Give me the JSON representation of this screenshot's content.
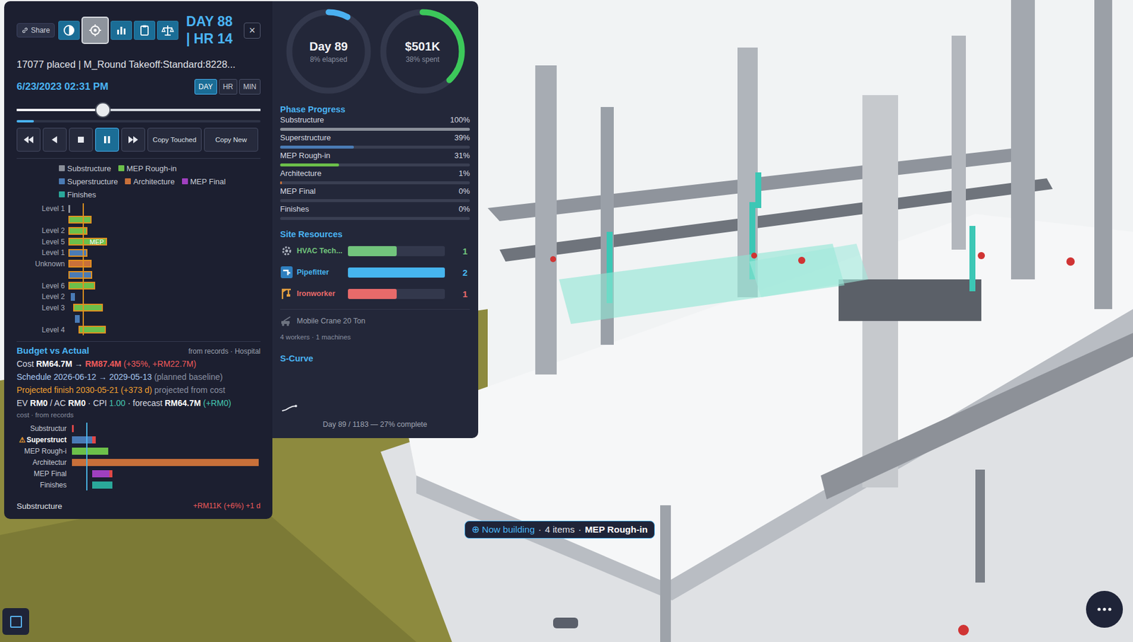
{
  "toolbar": {
    "share": "Share",
    "tools": [
      {
        "kind": "contrast",
        "selected": false
      },
      {
        "kind": "target",
        "selected": true
      },
      {
        "kind": "chart",
        "selected": false
      },
      {
        "kind": "clipboard",
        "selected": false
      },
      {
        "kind": "scales",
        "selected": false
      }
    ],
    "close": "×"
  },
  "clock": {
    "day": "DAY 88",
    "hour": "| HR 14"
  },
  "status": "17077 placed | M_Round Takeoff:Standard:8228...",
  "datetime": "6/23/2023 02:31 PM",
  "granularity": [
    {
      "label": "DAY",
      "selected": true
    },
    {
      "label": "HR",
      "selected": false
    },
    {
      "label": "MIN",
      "selected": false
    }
  ],
  "timeline": {
    "level": 0.354,
    "progress": 0.07
  },
  "playback": [
    {
      "kind": "rewind",
      "label": "",
      "selected": false
    },
    {
      "kind": "back",
      "label": "",
      "selected": false
    },
    {
      "kind": "stop",
      "label": "",
      "selected": false
    },
    {
      "kind": "pause",
      "label": "",
      "selected": true
    },
    {
      "kind": "forward",
      "label": "",
      "selected": false
    },
    {
      "kind": "text",
      "label": "Copy Touched",
      "selected": false
    },
    {
      "kind": "text",
      "label": "Copy New",
      "selected": false
    }
  ],
  "legend": [
    [
      {
        "label": "Substructure",
        "color": "#8a8f99"
      },
      {
        "label": "MEP Rough-in",
        "color": "#6cc04a"
      }
    ],
    [
      {
        "label": "Superstructure",
        "color": "#4a7bb5"
      },
      {
        "label": "Architecture",
        "color": "#c8703a"
      },
      {
        "label": "MEP Final",
        "color": "#a040c0"
      }
    ],
    [
      {
        "label": "Finishes",
        "color": "#2aa89a"
      }
    ]
  ],
  "schedule_chart": {
    "today": 0.075,
    "rows": [
      {
        "label": "Level 1",
        "start": 0,
        "end": 0.008,
        "color": "#8a8f99",
        "highlighted": false,
        "text": ""
      },
      {
        "label": "",
        "start": 0,
        "end": 0.12,
        "color": "#6cc04a",
        "highlighted": true,
        "text": ""
      },
      {
        "label": "Level 2",
        "start": 0,
        "end": 0.098,
        "color": "#6cc04a",
        "highlighted": true,
        "text": ""
      },
      {
        "label": "Level 5",
        "start": 0,
        "end": 0.2,
        "color": "#6cc04a",
        "highlighted": true,
        "text": "MEP"
      },
      {
        "label": "Level 1",
        "start": 0,
        "end": 0.098,
        "color": "#4a7bb5",
        "highlighted": true,
        "text": ""
      },
      {
        "label": "Unknown",
        "start": 0,
        "end": 0.12,
        "color": "#c8703a",
        "highlighted": true,
        "text": ""
      },
      {
        "label": "",
        "start": 0,
        "end": 0.124,
        "color": "#4a7bb5",
        "highlighted": true,
        "text": ""
      },
      {
        "label": "Level 6",
        "start": 0,
        "end": 0.139,
        "color": "#6cc04a",
        "highlighted": true,
        "text": ""
      },
      {
        "label": "Level 2",
        "start": 0.011,
        "end": 0.034,
        "color": "#4a7bb5",
        "highlighted": false,
        "text": ""
      },
      {
        "label": "Level 3",
        "start": 0.026,
        "end": 0.18,
        "color": "#6cc04a",
        "highlighted": true,
        "text": ""
      },
      {
        "label": "",
        "start": 0.034,
        "end": 0.06,
        "color": "#4a7bb5",
        "highlighted": false,
        "text": ""
      },
      {
        "label": "Level 4",
        "start": 0.053,
        "end": 0.195,
        "color": "#6cc04a",
        "highlighted": true,
        "text": ""
      }
    ]
  },
  "budget": {
    "title": "Budget vs Actual",
    "source": "from records · Hospital",
    "lines": [
      [
        {
          "text": "Cost ",
          "tone": "plain"
        },
        {
          "text": "RM64.7M",
          "tone": "strong"
        },
        {
          "text": " → ",
          "tone": "plain"
        },
        {
          "text": "RM87.4M",
          "tone": "bad-strong"
        },
        {
          "text": " (+35%, +RM22.7M)",
          "tone": "bad"
        }
      ],
      [
        {
          "text": "Schedule 2026-06-12 → 2029-05-13",
          "tone": "info"
        },
        {
          "text": " (planned baseline)",
          "tone": "muted"
        }
      ],
      [
        {
          "text": "Projected finish 2030-05-21 (+373 d)",
          "tone": "warn"
        },
        {
          "text": " projected from cost",
          "tone": "muted"
        }
      ],
      [
        {
          "text": "EV ",
          "tone": "plain"
        },
        {
          "text": "RM0",
          "tone": "strong"
        },
        {
          "text": " / AC ",
          "tone": "plain"
        },
        {
          "text": "RM0",
          "tone": "strong"
        },
        {
          "text": " · CPI ",
          "tone": "plain"
        },
        {
          "text": "1.00",
          "tone": "good"
        },
        {
          "text": " · forecast ",
          "tone": "plain"
        },
        {
          "text": "RM64.7M",
          "tone": "strong"
        },
        {
          "text": " (+RM0)",
          "tone": "good"
        }
      ]
    ],
    "caption": "cost · from records"
  },
  "budget_chart": {
    "today": 0.083,
    "rows": [
      {
        "label": "Substructur",
        "flag": "",
        "warning": false,
        "start": 0.008,
        "end": 0.008,
        "over": 0.019,
        "color": "#8a8f99"
      },
      {
        "label": "Superstruct",
        "flag": "⚠",
        "warning": true,
        "start": 0.008,
        "end": 0.117,
        "over": 0.133,
        "color": "#4a7bb5"
      },
      {
        "label": "MEP Rough-i",
        "flag": "",
        "warning": false,
        "start": 0.008,
        "end": 0.2,
        "over": 0.2,
        "color": "#6cc04a"
      },
      {
        "label": "Architectur",
        "flag": "",
        "warning": false,
        "start": 0.008,
        "end": 0.992,
        "over": 0.992,
        "color": "#c8703a"
      },
      {
        "label": "MEP Final",
        "flag": "",
        "warning": false,
        "start": 0.117,
        "end": 0.205,
        "over": 0.223,
        "color": "#a040c0"
      },
      {
        "label": "Finishes",
        "flag": "",
        "warning": false,
        "start": 0.117,
        "end": 0.223,
        "over": 0.223,
        "color": "#2aa89a"
      }
    ]
  },
  "footer": {
    "label": "Substructure",
    "delta": "+RM11K (+6%) +1 d"
  },
  "rings": [
    {
      "value": "Day 89",
      "caption": "8% elapsed",
      "level": 0.08,
      "color": "#4ab0f0"
    },
    {
      "value": "$501K",
      "caption": "38% spent",
      "level": 0.38,
      "color": "#3cc85a"
    }
  ],
  "phase_progress": {
    "title": "Phase Progress",
    "phases": [
      {
        "label": "Substructure",
        "percent": "100%",
        "level": 1,
        "color": "#8a8f99"
      },
      {
        "label": "Superstructure",
        "percent": "39%",
        "level": 0.39,
        "color": "#4a7bb5"
      },
      {
        "label": "MEP Rough-in",
        "percent": "31%",
        "level": 0.31,
        "color": "#6cc04a"
      },
      {
        "label": "Architecture",
        "percent": "1%",
        "level": 0.01,
        "color": "#c8703a"
      },
      {
        "label": "MEP Final",
        "percent": "0%",
        "level": 0,
        "color": "#a040c0"
      },
      {
        "label": "Finishes",
        "percent": "0%",
        "level": 0,
        "color": "#2aa89a"
      }
    ]
  },
  "site_resources": {
    "title": "Site Resources",
    "workers": [
      {
        "kind": "hvac",
        "label": "HVAC Tech...",
        "count": "1",
        "level": 0.5,
        "color": "#72c47c"
      },
      {
        "kind": "pipe",
        "label": "Pipefitter",
        "count": "2",
        "level": 1,
        "color": "#46b4ee"
      },
      {
        "kind": "iron",
        "label": "Ironworker",
        "count": "1",
        "level": 0.5,
        "color": "#e86a6a"
      }
    ],
    "machines": [
      {
        "label": "Mobile Crane 20 Ton"
      }
    ],
    "summary": "4 workers · 1 machines"
  },
  "s_curve": {
    "title": "S-Curve",
    "total_days": 1183,
    "days": [
      0,
      22,
      44,
      66,
      89
    ],
    "values": [
      0,
      2,
      6,
      9,
      10
    ],
    "caption": "Day 89 / 1183 — 27% complete"
  },
  "now_building": {
    "icon": "⊕",
    "label": "Now building",
    "separator": "·",
    "count": "4 items",
    "phase": "MEP Rough-in"
  }
}
